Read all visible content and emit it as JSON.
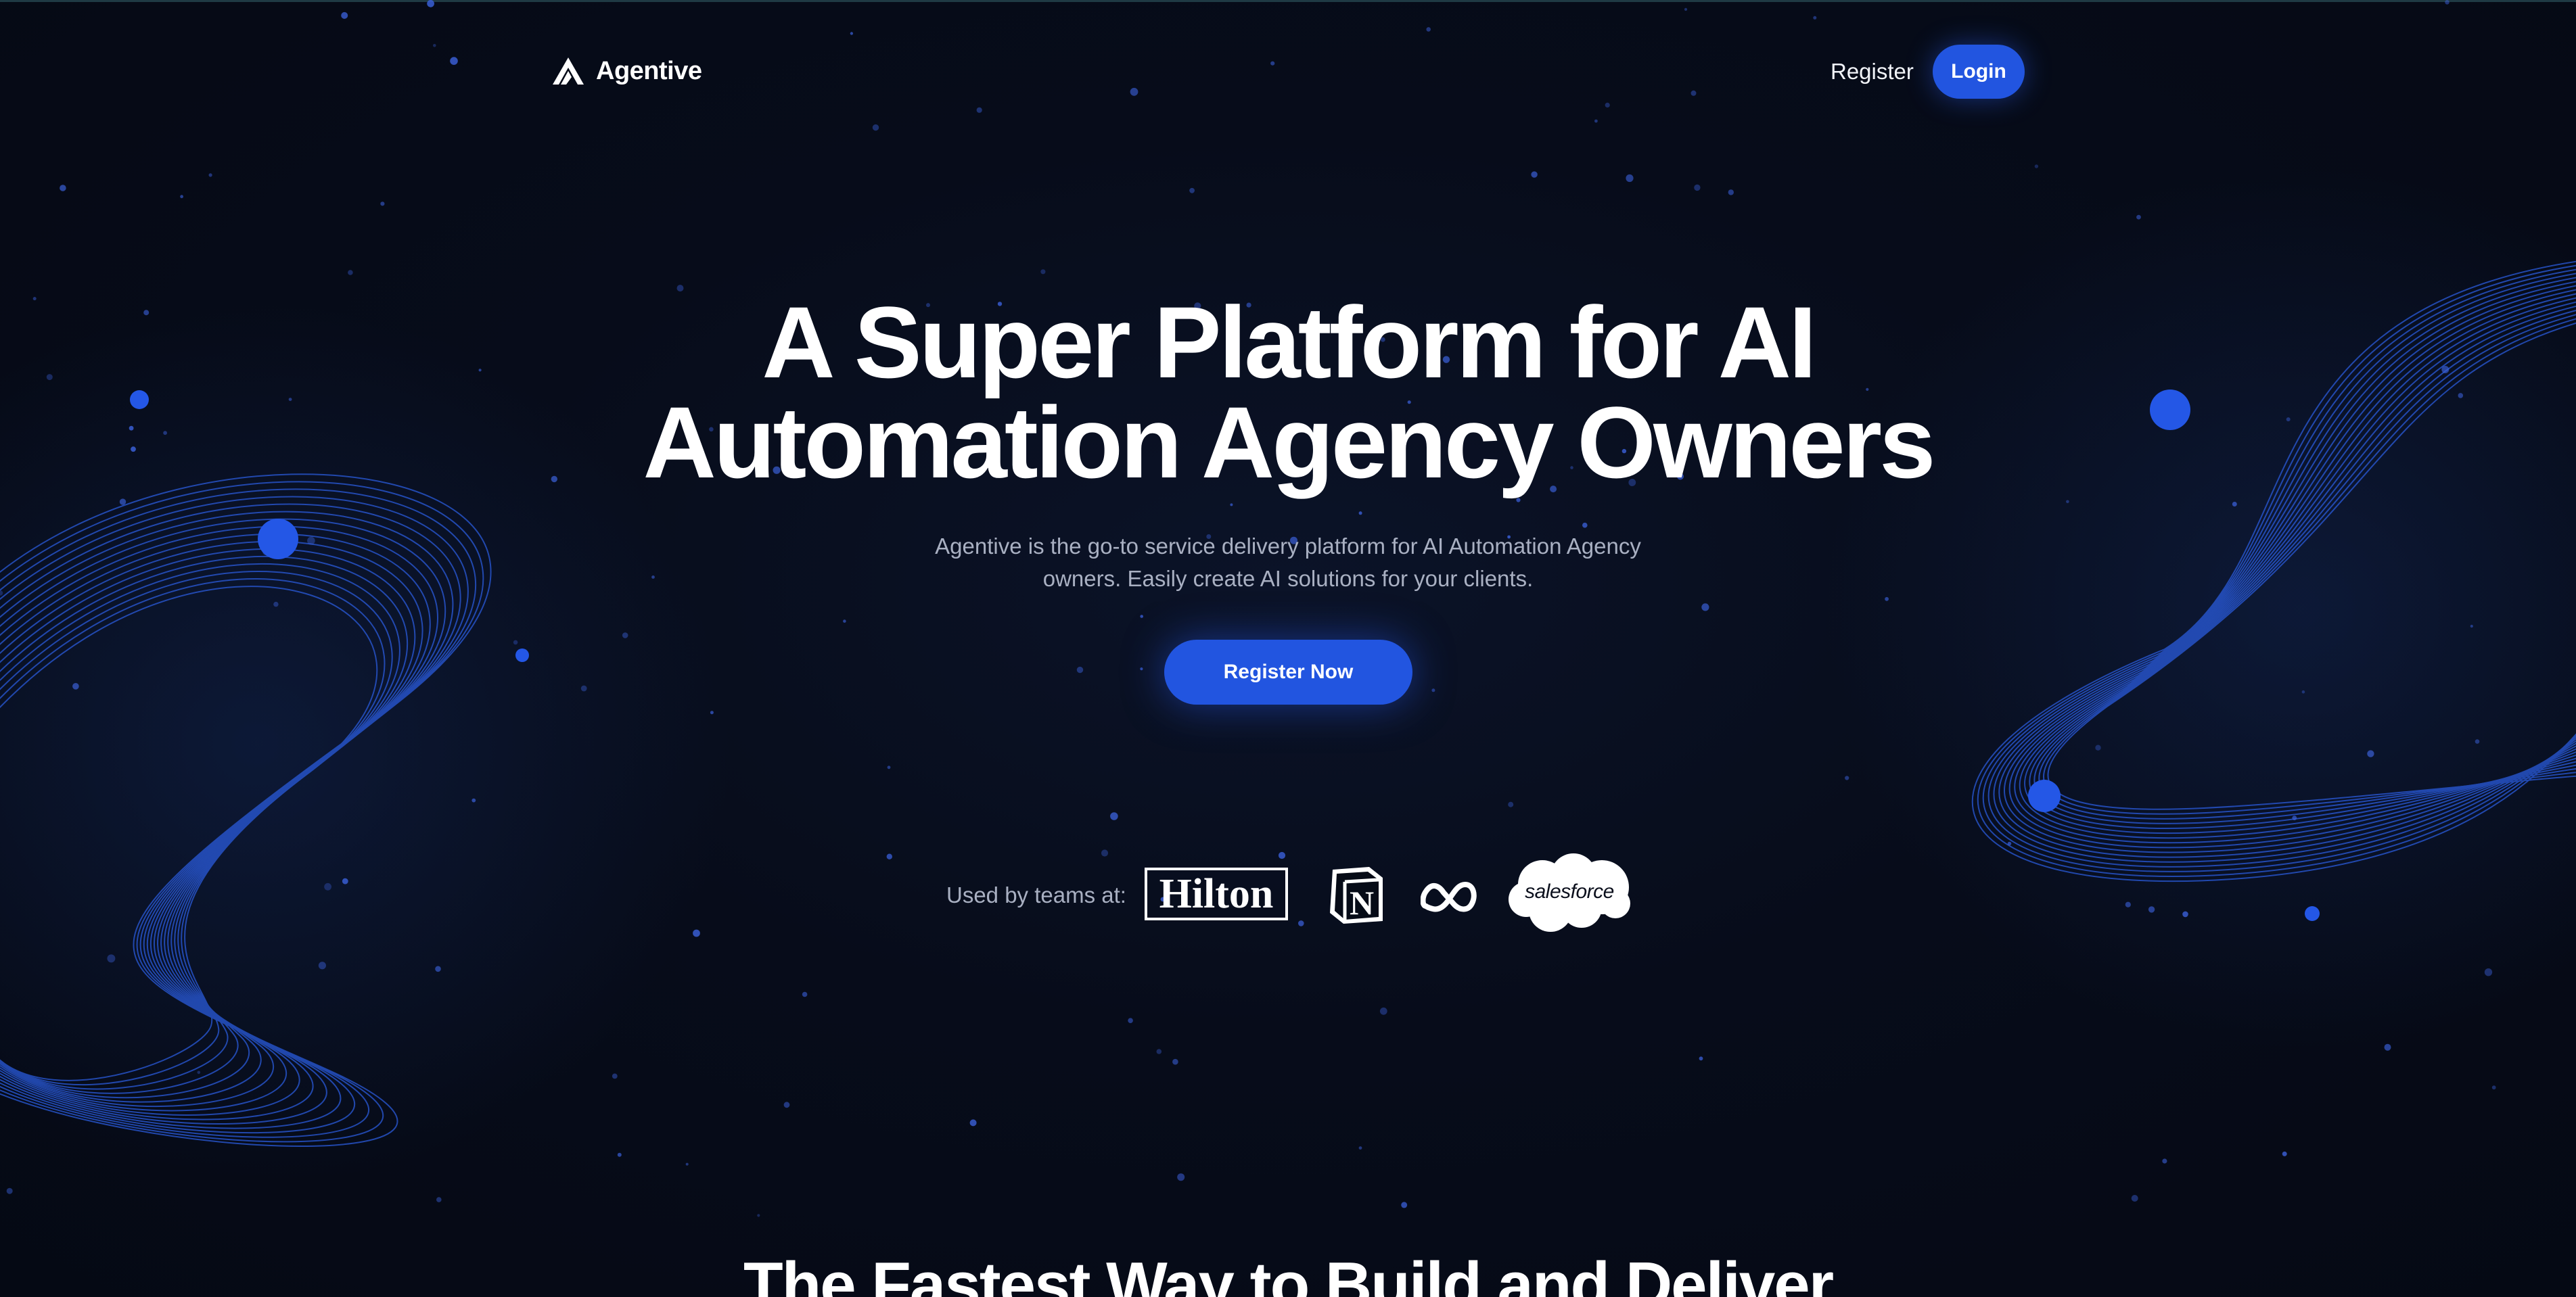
{
  "app": {
    "brand_name": "Agentive",
    "accent_color": "#2255e0",
    "background_color": "#060b17"
  },
  "nav": {
    "register_label": "Register",
    "login_label": "Login"
  },
  "hero": {
    "title_line1": "A Super Platform for AI",
    "title_line2": "Automation Agency Owners",
    "subtitle": "Agentive is the go-to service delivery platform for AI Automation Agency owners. Easily create AI solutions for your clients.",
    "cta_label": "Register Now"
  },
  "trusted": {
    "label": "Used by teams at:",
    "logos": [
      {
        "name": "Hilton",
        "text": "Hilton",
        "icon": "hilton-logo"
      },
      {
        "name": "Notion",
        "text": "N",
        "icon": "notion-logo"
      },
      {
        "name": "Meta",
        "icon": "meta-logo"
      },
      {
        "name": "Salesforce",
        "text": "salesforce",
        "icon": "salesforce-logo"
      }
    ]
  },
  "next_section": {
    "title": "The Fastest Way to Build and Deliver"
  }
}
